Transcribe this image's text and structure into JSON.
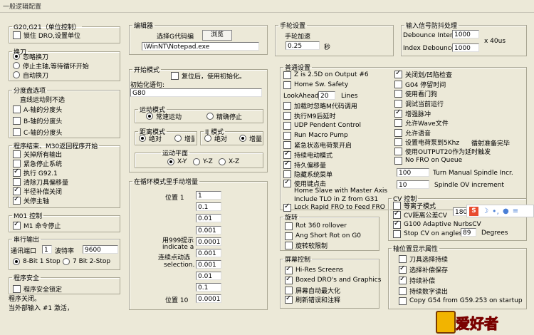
{
  "window": {
    "title": "一般逻辑配置"
  },
  "g20g21": {
    "title": "G20,G21（单位控制）",
    "lock_label": "锁住 DRO,设置单位",
    "lock": false
  },
  "toolchange": {
    "title": "换刀",
    "options": [
      "忽略换刀",
      "停止主轴,等待循环开始",
      "自动换刀"
    ],
    "selected": 0
  },
  "indexer": {
    "title": "分度盘选项",
    "subtitle": "直线运动则不选",
    "items": [
      {
        "label": "A-轴的分度头",
        "checked": false
      },
      {
        "label": "B-轴的分度头",
        "checked": false
      },
      {
        "label": "C-轴的分度头",
        "checked": false
      }
    ]
  },
  "program_end": {
    "title": "程序结束、M30返回程序开始",
    "items": [
      {
        "label": "关掉所有输出",
        "checked": false
      },
      {
        "label": "紧急停止系统",
        "checked": false
      },
      {
        "label": "执行 G92.1",
        "checked": true
      },
      {
        "label": "清除刀具偏移量",
        "checked": false
      },
      {
        "label": "半径补偿关闭",
        "checked": true
      },
      {
        "label": "关停主轴",
        "checked": true
      }
    ]
  },
  "m01": {
    "title": "M01 控制",
    "label": "M1 命令停止",
    "checked": true
  },
  "serial": {
    "title": "串行输出",
    "port_label": "通讯端口",
    "port": "1",
    "baud_label": "波特率",
    "baud": "9600",
    "options": [
      "8-Bit 1 Stop",
      "7 Bit 2-Stop"
    ],
    "selected": 0
  },
  "security": {
    "title": "程序安全",
    "lock_label": "程序安全锁定",
    "checked": false,
    "note1": "程序关闭。",
    "note2": "当外部输入 #1 激活，"
  },
  "editor": {
    "title": "编辑器",
    "choose_label": "选择G代码编",
    "browse": "浏览",
    "path": "\\WinNT\\Notepad.exe"
  },
  "startup": {
    "title": "开始模式",
    "reset_label": "复位后，使用初始化。",
    "reset": false,
    "init_label": "初始化语句:",
    "init_value": "G80",
    "motion": {
      "title": "运动模式",
      "options": [
        "常速运动",
        "精确停止"
      ],
      "selected": 0
    },
    "distance": {
      "title": "距离模式",
      "options": [
        "绝对",
        "增量"
      ],
      "selected": 0
    },
    "ij": {
      "title": "IJ 模式",
      "options": [
        "绝对",
        "增量"
      ],
      "selected": 1
    },
    "plane": {
      "title": "运动平面",
      "options": [
        "X-Y",
        "Y-Z",
        "X-Z"
      ],
      "selected": 0
    }
  },
  "jog": {
    "title": "在循环模式里手动增量",
    "pos1": "位置 1",
    "pos10": "位置 10",
    "note": [
      "用999提示",
      "indicate a",
      "连续点动选",
      "selection."
    ],
    "values": [
      "1",
      "0.1",
      "0.01",
      "0.001",
      "0.0001",
      "0.001",
      "0.001",
      "0.01",
      "0.1",
      "0.0001"
    ]
  },
  "mpg": {
    "title": "手轮设置",
    "accel_label": "手轮加速",
    "accel": "0.25",
    "unit": "秒"
  },
  "debounce": {
    "title": "输入信号防抖处理",
    "interval_label": "Debounce Interval",
    "interval": "1000",
    "index_label": "Index Debounce",
    "index": "1000",
    "unit": "x 40us"
  },
  "general": {
    "title": "普通设置",
    "left": [
      {
        "label": "Z is 2.5D on Output #6",
        "checked": false
      },
      {
        "label": "Home Sw. Safety",
        "checked": false
      },
      {
        "label": "加载时忽略M代码调用",
        "checked": false
      },
      {
        "label": "执行M9后延时",
        "checked": false
      },
      {
        "label": "UDP Pendent Control",
        "checked": false
      },
      {
        "label": "Run Macro Pump",
        "checked": false
      },
      {
        "label": "紧急状态电荷泵开启",
        "checked": false
      },
      {
        "label": "持续电动模式",
        "checked": true
      },
      {
        "label": "持久偏移量",
        "checked": true
      },
      {
        "label": "隐藏系统菜单",
        "checked": false
      },
      {
        "label": "使用键点击",
        "checked": true
      },
      {
        "label": "Home Slave with Master Axis",
        "checked": false
      },
      {
        "label": "Include TLO in Z from G31",
        "checked": false
      },
      {
        "label": "Lock Rapid FRO to Feed FRO",
        "checked": true
      }
    ],
    "lookahead_label": "LookAhead",
    "lookahead": "20",
    "lines": "Lines",
    "right": [
      {
        "label": "关闭划/凹陷检查",
        "checked": true
      },
      {
        "label": "G04 停留时间",
        "checked": false
      },
      {
        "label": "使用看门狗",
        "checked": false
      },
      {
        "label": "调试当前运行",
        "checked": false
      },
      {
        "label": "增强脉冲",
        "checked": true
      },
      {
        "label": "允许Wave文件",
        "checked": false
      },
      {
        "label": "允许语音",
        "checked": false
      },
      {
        "label": "设置电荷泵到5Khz",
        "checked": false
      },
      {
        "label": "使用OUTPUT20作为延时触发",
        "checked": false
      },
      {
        "label": "No FRO on Queue",
        "checked": false
      }
    ],
    "charge_note": "循射准备完毕",
    "spindle_inc": "100",
    "spindle_inc_label": "Turn Manual Spindle Incr.",
    "spindle_ov": "10",
    "spindle_ov_label": "Spindle OV increment"
  },
  "rotary": {
    "title": "旋转",
    "items": [
      {
        "label": "Rot 360 rollover",
        "checked": false
      },
      {
        "label": "Ang Short Rot on G0",
        "checked": false
      },
      {
        "label": "旋转软限制",
        "checked": false
      }
    ]
  },
  "cv": {
    "title": "CV 控制",
    "items": [
      {
        "label": "等离子模式",
        "checked": false
      },
      {
        "label": "CV距离公差CV",
        "checked": true,
        "value": "180"
      },
      {
        "label": "G100 Adaptive NurbsCV",
        "checked": true
      },
      {
        "label": "Stop CV on angles >",
        "checked": false,
        "value": "89",
        "unit": "Degrees"
      }
    ]
  },
  "screen": {
    "title": "屏幕控制",
    "items": [
      {
        "label": "Hi-Res Screens",
        "checked": true
      },
      {
        "label": "Boxed DRO's and Graphics",
        "checked": true
      },
      {
        "label": "屏幕自动最大化",
        "checked": false
      },
      {
        "label": "刷新错误和注释",
        "checked": true
      }
    ]
  },
  "axis_disp": {
    "title": "轴位置显示属性",
    "items": [
      {
        "label": "刀具选择持续",
        "checked": false
      },
      {
        "label": "选择补偿保存",
        "checked": true
      },
      {
        "label": "持续补偿",
        "checked": true
      },
      {
        "label": "持续数字读出",
        "checked": false
      },
      {
        "label": "Copy G54 from G59.253 on startup",
        "checked": false
      }
    ]
  },
  "ime": {
    "logo": "S"
  },
  "watermark": {
    "text": "爱好者"
  }
}
